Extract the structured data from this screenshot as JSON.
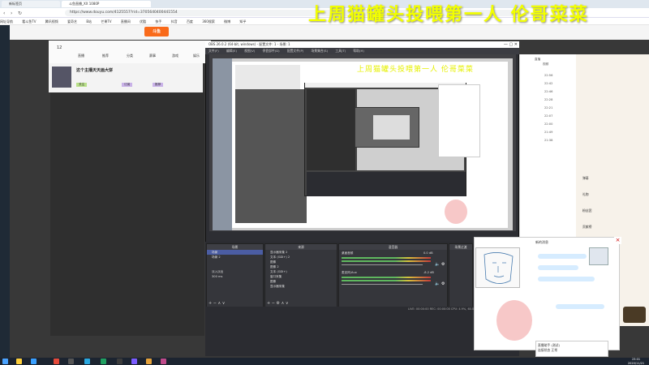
{
  "browser": {
    "tabs": [
      {
        "label": "新标签页"
      },
      {
        "label": "斗鱼直播_XX 1080P"
      }
    ],
    "url": "https://www.douyu.com/4125557?rid=3705640400441554",
    "bookmarks": [
      "网址导航",
      "看斗鱼TV",
      "腾讯视频",
      "爱奇艺",
      "B站",
      "芒果TV",
      "直播间",
      "优酷",
      "快手",
      "抖音",
      "百度",
      "360搜索",
      "微博",
      "知乎"
    ]
  },
  "overlay": {
    "title": "上周猫罐头投喂第一人 伦哥菜菜"
  },
  "site": {
    "logo": "斗鱼",
    "nav": [
      "12",
      "直播",
      "推荐",
      "分类",
      "赛事",
      "游戏",
      "娱乐"
    ],
    "streamer_name": "这个主播天天画大饼",
    "streamer_tags": [
      "关注",
      "订阅",
      "推荐"
    ],
    "right_panel": [
      "直播",
      "视频",
      "22:56",
      "22:42",
      "22:46",
      "22:28",
      "22:21",
      "22:07",
      "22:00",
      "21:49",
      "21:38"
    ],
    "far_right": [
      "弹幕",
      "礼物",
      "粉丝团",
      "贡献榜"
    ]
  },
  "obs": {
    "title": "OBS 26.0.2 (64-bit, windows) - 配置文件: 1 - 场景: 1",
    "menu": [
      "文件(F)",
      "编辑(E)",
      "视图(V)",
      "停靠部件(D)",
      "配置文件(P)",
      "场景集合(S)",
      "工具(T)",
      "帮助(H)"
    ],
    "preview_overlay": "上周猫罐头投喂第一人 伦哥菜菜",
    "docks": {
      "scenes_title": "场景",
      "sources_title": "来源",
      "mixer_title": "混音器",
      "transitions_title": "场景过渡",
      "controls_title": "控件"
    },
    "scenes": [
      "场景",
      "场景 2"
    ],
    "sources": [
      "显示器采集 2",
      "文本 (GDI+) 2",
      "图像",
      "图像 2",
      "文本 (GDI+)",
      "窗口采集",
      "图像",
      "显示器采集"
    ],
    "mixer": [
      {
        "name": "桌面音频",
        "level": "0.0 dB"
      },
      {
        "name": "麦克风/Aux",
        "level": "-8.2 dB"
      }
    ],
    "transition": {
      "type": "淡入淡出",
      "duration": "300 ms"
    },
    "status": "LIVE: 00:00:00   REC: 00:00:00   CPU: 4.9%, 60.00 fps"
  },
  "chat": {
    "title": "新的消息",
    "messages": [
      "",
      "",
      "",
      ""
    ],
    "close": "×"
  },
  "qa": {
    "title": "直播助手 (测试)",
    "line": "连接状态 正常"
  },
  "taskbar": {
    "time": "23:01",
    "date": "2020/11/21"
  }
}
